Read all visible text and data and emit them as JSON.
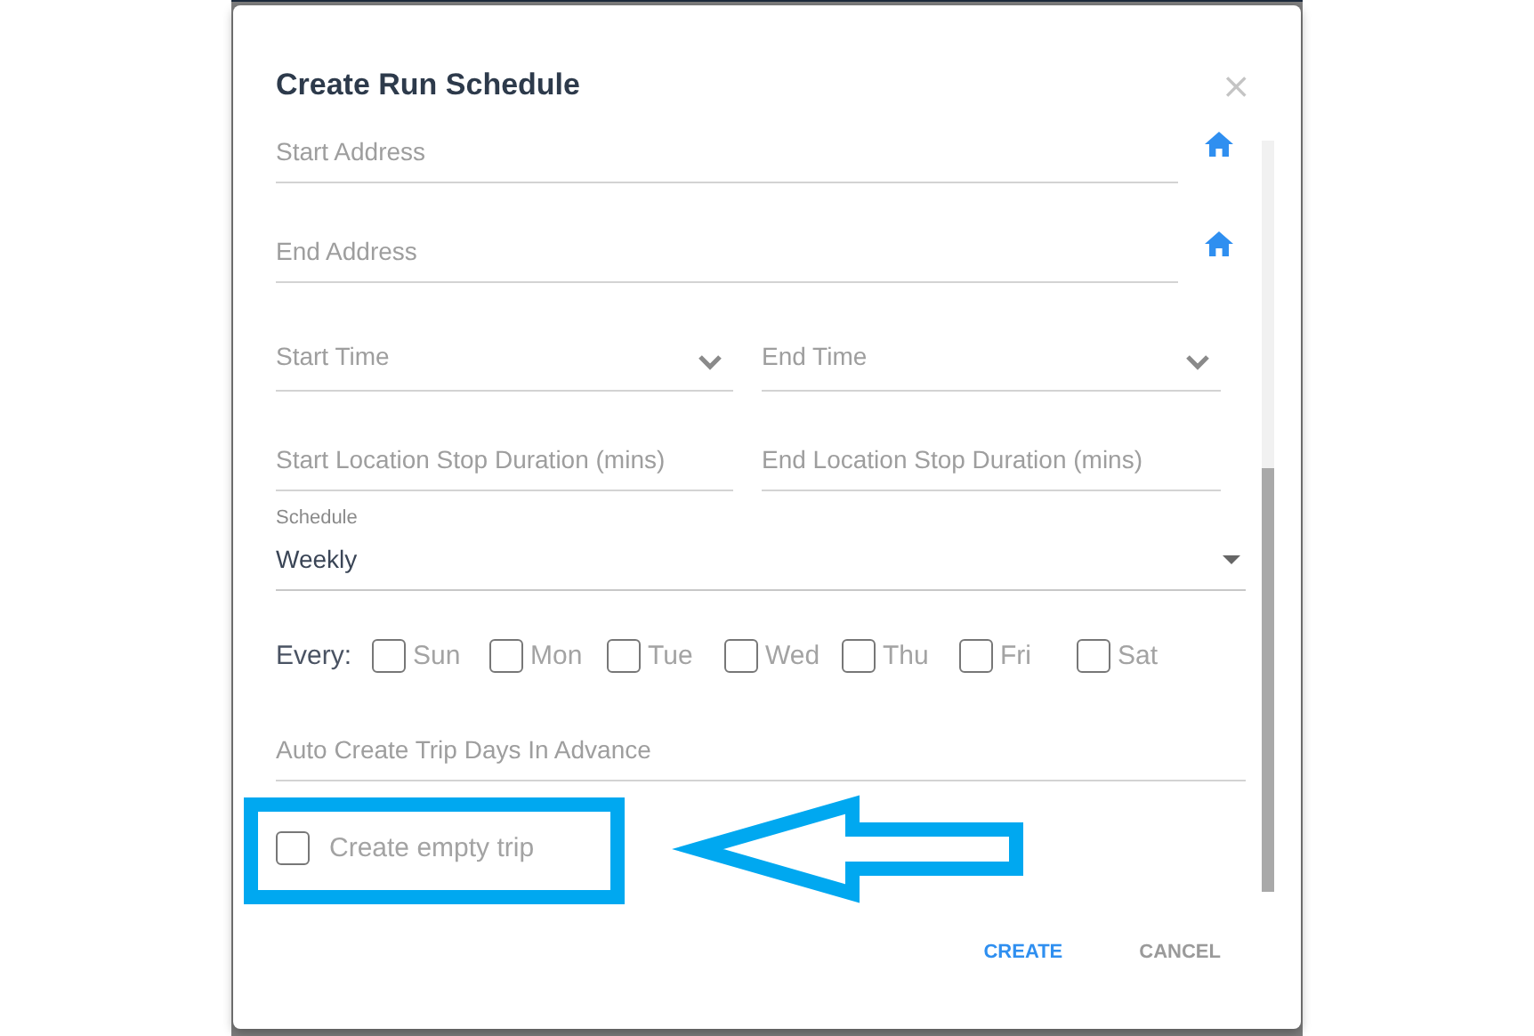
{
  "dialog": {
    "title": "Create Run Schedule",
    "close": "×"
  },
  "address_fields": [
    {
      "placeholder": "Start Address"
    },
    {
      "placeholder": "End Address"
    }
  ],
  "time_fields": [
    {
      "placeholder": "Start Time"
    },
    {
      "placeholder": "End Time"
    }
  ],
  "duration_fields": [
    {
      "placeholder": "Start Location Stop Duration (mins)"
    },
    {
      "placeholder": "End Location Stop Duration (mins)"
    }
  ],
  "schedule": {
    "label": "Schedule",
    "value": "Weekly"
  },
  "every": {
    "label": "Every:",
    "days": [
      {
        "label": "Sun",
        "checked": false
      },
      {
        "label": "Mon",
        "checked": false
      },
      {
        "label": "Tue",
        "checked": false
      },
      {
        "label": "Wed",
        "checked": false
      },
      {
        "label": "Thu",
        "checked": false
      },
      {
        "label": "Fri",
        "checked": false
      },
      {
        "label": "Sat",
        "checked": false
      }
    ]
  },
  "advance_field": {
    "placeholder": "Auto Create Trip Days In Advance"
  },
  "empty_trip": {
    "label": "Create empty trip",
    "checked": false
  },
  "buttons": [
    {
      "label": "CREATE",
      "kind": "primary"
    },
    {
      "label": "CANCEL",
      "kind": "secondary"
    }
  ]
}
